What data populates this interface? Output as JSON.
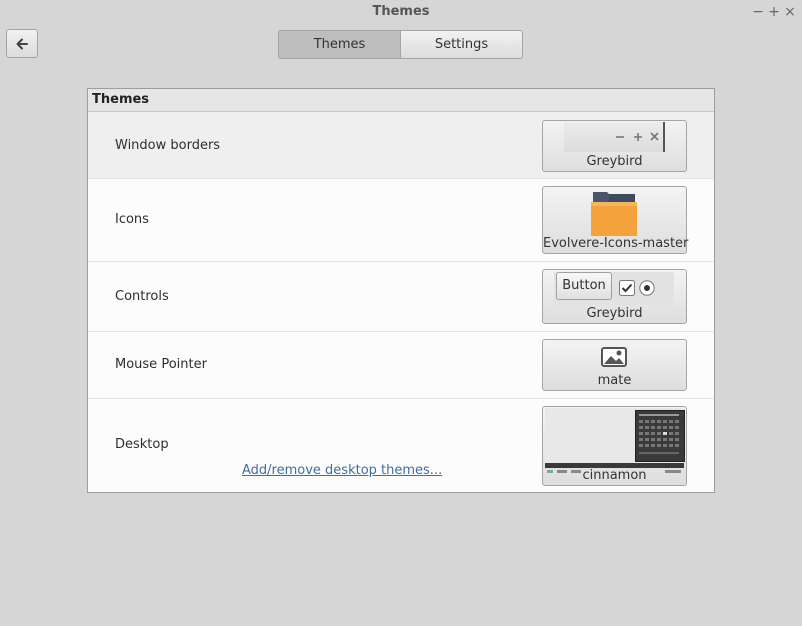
{
  "window": {
    "title": "Themes",
    "controls": {
      "minimize": "−",
      "maximize": "+",
      "close": "×"
    }
  },
  "nav": {
    "back_icon": "arrow-left-icon",
    "tabs": [
      {
        "label": "Themes",
        "active": true
      },
      {
        "label": "Settings",
        "active": false
      }
    ]
  },
  "panel": {
    "header": "Themes",
    "rows": [
      {
        "label": "Window borders",
        "value": "Greybird",
        "preview_icon": "window-controls-preview"
      },
      {
        "label": "Icons",
        "value": "Evolvere-Icons-master",
        "preview_icon": "folder-icon"
      },
      {
        "label": "Controls",
        "value": "Greybird",
        "preview_icon": "controls-preview",
        "preview_button_label": "Button"
      },
      {
        "label": "Mouse Pointer",
        "value": "mate",
        "preview_icon": "image-icon"
      },
      {
        "label": "Desktop",
        "value": "cinnamon",
        "preview_icon": "desktop-preview",
        "link": "Add/remove desktop themes..."
      }
    ]
  },
  "colors": {
    "background": "#d6d6d6",
    "active_tab": "#bdbdbd",
    "link": "#3d6ea5",
    "folder": "#f0a040"
  }
}
